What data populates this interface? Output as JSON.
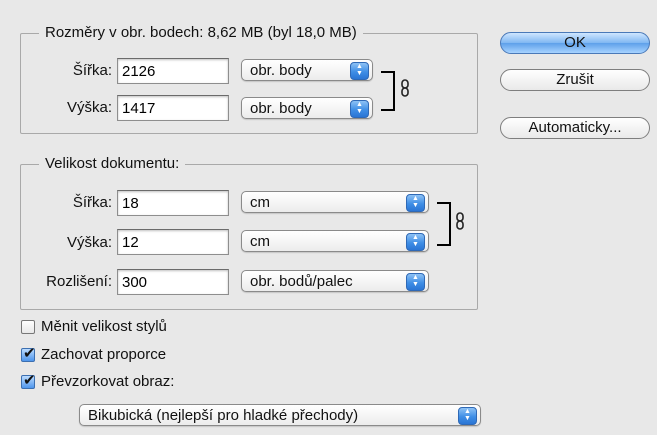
{
  "pixels_group": {
    "title": "Rozměry v obr. bodech:  8,62 MB (byl 18,0 MB)",
    "width_label": "Šířka:",
    "width_value": "2126",
    "width_unit": "obr. body",
    "height_label": "Výška:",
    "height_value": "1417",
    "height_unit": "obr. body"
  },
  "document_group": {
    "title": "Velikost dokumentu:",
    "width_label": "Šířka:",
    "width_value": "18",
    "width_unit": "cm",
    "height_label": "Výška:",
    "height_value": "12",
    "height_unit": "cm",
    "resolution_label": "Rozlišení:",
    "resolution_value": "300",
    "resolution_unit": "obr. bodů/palec"
  },
  "buttons": {
    "ok": "OK",
    "cancel": "Zrušit",
    "auto": "Automaticky..."
  },
  "options": {
    "scale_styles": {
      "label": "Měnit velikost stylů",
      "checked": false
    },
    "constrain": {
      "label": "Zachovat proporce",
      "checked": true
    },
    "resample": {
      "label": "Převzorkovat obraz:",
      "checked": true
    },
    "resample_method": "Bikubická (nejlepší pro hladké přechody)"
  },
  "colors": {
    "accent": "#3f8ee6",
    "background": "#e8e8e8"
  },
  "icons": {
    "link": "chain-link-icon",
    "stepper": "up-down-arrows-icon",
    "check": "check-mark-icon"
  }
}
